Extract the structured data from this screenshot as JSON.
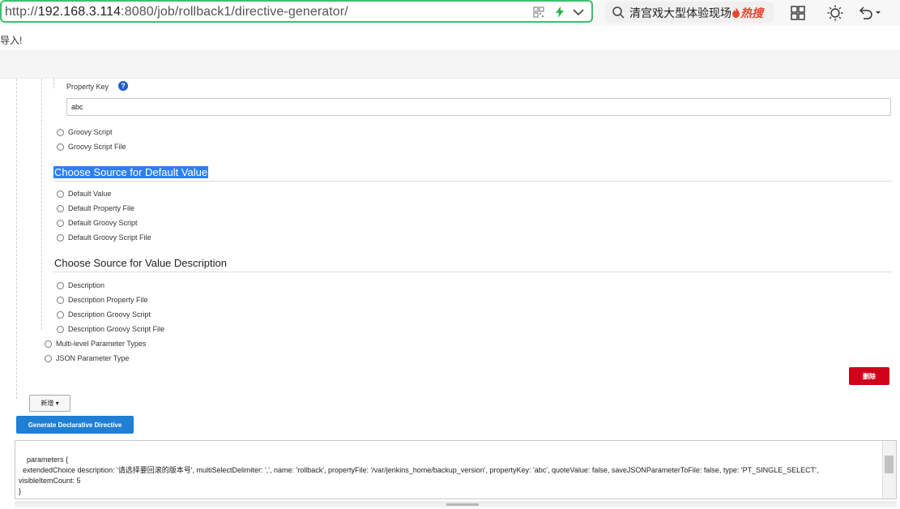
{
  "browser": {
    "url_prefix": "http://",
    "url_host": "192.168.3.114",
    "url_path": ":8080/job/rollback1/directive-generator/",
    "search_text": "清宫戏大型体验现场",
    "search_hot": "热搜",
    "icons": [
      "qr-code-icon",
      "lightning-icon",
      "chevron-down-icon",
      "search-icon",
      "fire-icon",
      "grid-icon",
      "brightness-icon",
      "undo-icon"
    ],
    "accent": "#3fbf6f"
  },
  "notice": "导入!",
  "form": {
    "property_key_label": "Property Key",
    "property_key_help": "?",
    "property_key_value": "abc",
    "value_source_options": [
      "Groovy Script",
      "Groovy Script File"
    ],
    "default_section_title": "Choose Source for Default Value",
    "default_options": [
      "Default Value",
      "Default Property File",
      "Default Groovy Script",
      "Default Groovy Script File"
    ],
    "description_section_title": "Choose Source for Value Description",
    "description_options": [
      "Description",
      "Description Property File",
      "Description Groovy Script",
      "Description Groovy Script File"
    ],
    "parameter_type_options": [
      "Multi-level Parameter Types",
      "JSON Parameter Type"
    ]
  },
  "actions": {
    "delete_label": "删除",
    "add_label": "新增",
    "generate_label": "Generate Declarative Directive",
    "delete_color": "#d0021b",
    "generate_color": "#1f7fd4"
  },
  "output": {
    "text": "parameters {\n  extendedChoice description: '请选择要回滚的版本号', multiSelectDelimiter: ',', name: 'rollback', propertyFile: '/var/jenkins_home/backup_version', propertyKey: 'abc', quoteValue: false, saveJSONParameterToFile: false, type: 'PT_SINGLE_SELECT',\nvisibleItemCount: 5\n}"
  }
}
